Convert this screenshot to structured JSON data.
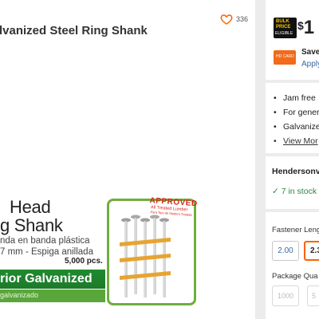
{
  "product": {
    "title": "lvanized Steel Ring Shank",
    "favorite_count": "336"
  },
  "box_art": {
    "head_line1": "Head",
    "head_line2": "g Shank",
    "spanish_line1": "nda en banda plástica",
    "spanish_line2": "7 mm - Espiga anillada",
    "count": "5,000 pcs.",
    "band_text": "rior Galvanized",
    "band_sub": "galvanizado",
    "stamp_main": "APPROVED",
    "stamp_sub": "All Treated Lumber",
    "stamp_sub2": "Para Tipo de Madera Tratada"
  },
  "pricing": {
    "badge_line1": "BULK",
    "badge_line2": "PRICE",
    "badge_line3": "ELIGIBLE",
    "price_dollar": "$",
    "price_value": "1",
    "card_text": "HD CARD",
    "save_text": "Save",
    "apply_text": "Apply"
  },
  "highlights": [
    "Jam free",
    "For gener",
    "Galvanize",
    "View Mor"
  ],
  "store": {
    "name": "Hendersonv",
    "stock": "✓ 7 in stock"
  },
  "options": {
    "fastener_label": "Fastener Leng",
    "lengths": [
      "2.00",
      "2.3"
    ],
    "package_label": "Package Qua",
    "quantities": [
      "1000",
      "5"
    ]
  },
  "colors": {
    "accent": "#f96302",
    "link": "#3b6aa0",
    "stock_green": "#2e8540",
    "box_green": "#1f8a2f",
    "stamp_red": "#d9261c"
  }
}
